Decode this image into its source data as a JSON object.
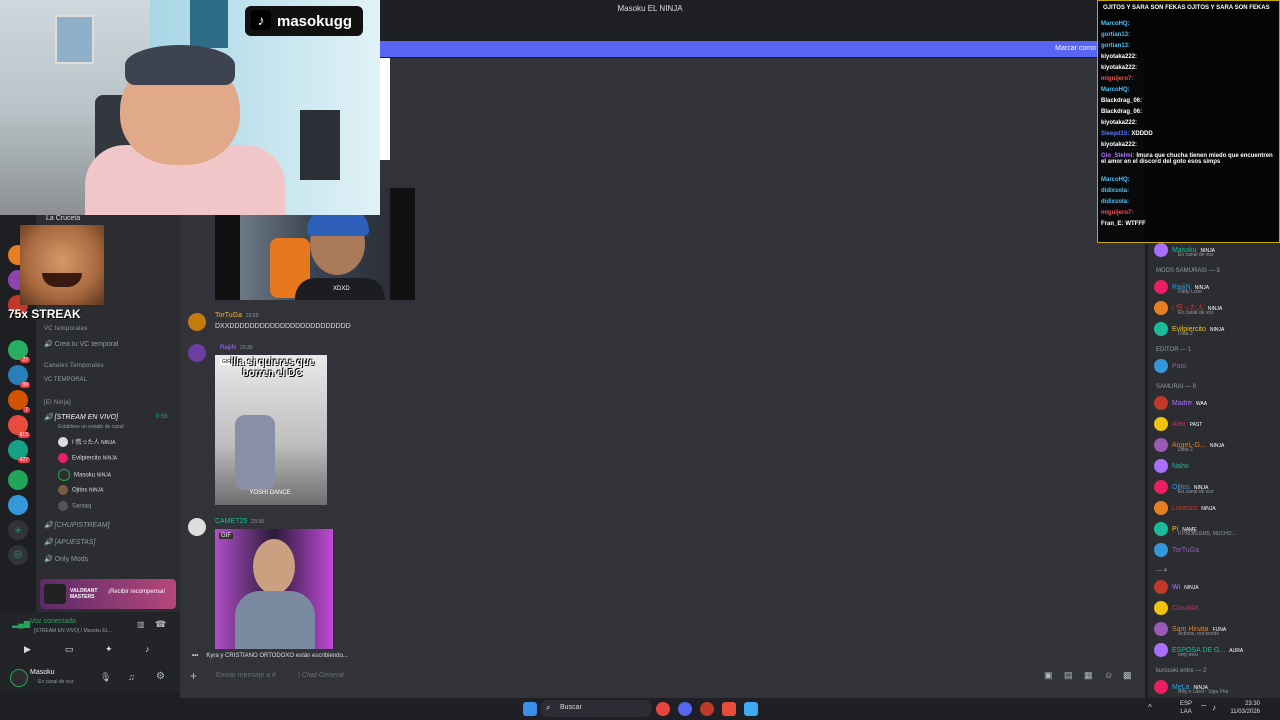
{
  "window": {
    "title": "Masoku EL NINJA"
  },
  "banner": {
    "text": "Marcar como"
  },
  "overlay": {
    "tiktok_handle": "masokugg",
    "streak": "75x STREAK",
    "cam2_label": "XDXD"
  },
  "sidebar": {
    "server_name": "La Cruceta",
    "category1": "VC temporales",
    "create_vc": "Crea tu VC temporal",
    "category2": "Canales Temporales",
    "vc_temporal": "VC TEMPORAL",
    "category3": "[El Ninja]",
    "live_channel": "[STREAM EN VIVO]",
    "live_time": "8:56",
    "live_status": "Establece un estado de canal",
    "voice_users": [
      {
        "name": "I 慌った人",
        "tag": "NINJA"
      },
      {
        "name": "Evilpiercito",
        "tag": "NINJA"
      },
      {
        "name": "Masoku",
        "tag": "NINJA"
      },
      {
        "name": "Ojitos",
        "tag": "NINJA"
      },
      {
        "name": "Saraaq",
        "tag": ""
      }
    ],
    "channels": [
      "[CHUPISTREAM]",
      "[APUESTAS]",
      "Only Mods"
    ],
    "promo_title": "VALORANT MASTERS",
    "promo_button": "¡Recibir recompensa!",
    "voice_connected": "Voz conectada",
    "voice_channel": "[STREAM EN VIVO] / Masoku EL...",
    "user_name": "Masoku",
    "user_status": "En canal de voz"
  },
  "chat": {
    "messages": [
      {
        "author": "TorTuGa",
        "time": "23:29",
        "text": "DXXDDDDDDDDDDDDDDDDDDDDDDDD",
        "color": "#c27c0e"
      },
      {
        "author": "RaijiN",
        "time": "23:30",
        "gif_caption": "illa si quieres que borren el DC",
        "gif_footer": "YOSHI DANCE",
        "color": "#a970ff"
      },
      {
        "author": "CAMET25",
        "time": "23:30",
        "gif_badge": "GIF",
        "color": "#1abc9c"
      }
    ],
    "typing": "Kyra y CRISTIANO ORTODOXO están escribiendo...",
    "composer_placeholder": "Enviar mensaje a #",
    "composer_channel": "| Chat-General"
  },
  "members": {
    "groups": [
      {
        "header": "NINJA SUPREMO — 1",
        "items": [
          {
            "name": "Masoku",
            "sub": "En canal de voz",
            "tag": "NINJA"
          }
        ]
      },
      {
        "header": "MODS SAMURAIS — 3",
        "items": [
          {
            "name": "RaijiN",
            "sub": "Dutty Love",
            "tag": "NINJA"
          },
          {
            "name": "I 慌った人",
            "sub": "En canal de voz",
            "tag": "NINJA"
          },
          {
            "name": "Evilpiercito",
            "sub": "Dota 2",
            "tag": "NINJA"
          }
        ]
      },
      {
        "header": "EDITOR — 1",
        "items": [
          {
            "name": "Pato",
            "sub": "",
            "tag": ""
          }
        ]
      },
      {
        "header": "SAMURAI — 8",
        "items": [
          {
            "name": "Madre",
            "sub": "",
            "tag": "WAA"
          },
          {
            "name": "Alex",
            "sub": "",
            "tag": "PAST"
          },
          {
            "name": "AngeL-G...",
            "sub": "Dota 2",
            "tag": "NINJA"
          },
          {
            "name": "Naho",
            "sub": "",
            "tag": ""
          },
          {
            "name": "Ojitos",
            "sub": "En canal de voz",
            "tag": "NINJA"
          },
          {
            "name": "Lorenzo",
            "sub": "",
            "tag": "NINJA"
          },
          {
            "name": "Pi",
            "sub": "0 PROBLEMS, MUCHO...",
            "tag": "NAME"
          },
          {
            "name": "TorTuGa",
            "sub": "",
            "tag": ""
          }
        ]
      },
      {
        "header": "— 4",
        "items": [
          {
            "name": "Wi",
            "sub": "",
            "tag": "NINJA"
          },
          {
            "name": "Cloud48",
            "sub": "",
            "tag": ""
          },
          {
            "name": "Sam Hinata",
            "sub": "Actions, not words",
            "tag": "FUNA"
          },
          {
            "name": "ESPOSA DE G...",
            "sub": "only uwu",
            "tag": "AURA"
          }
        ]
      },
      {
        "header": "kurosoki entre — 2",
        "items": [
          {
            "name": "MeLa",
            "sub": "Billy n Lded - Siga Fha",
            "tag": "NINJA"
          }
        ]
      }
    ]
  },
  "twitch_chat": {
    "lines": [
      {
        "user": "",
        "text": "OJITOS Y SARA SON FEKAS OJITOS Y SARA SON FEKAS",
        "color": "#ffffff"
      },
      {
        "user": "MarcoHQ:",
        "text": "",
        "color": "#4fc3f7"
      },
      {
        "user": "gortian13:",
        "text": "",
        "color": "#4fc3f7"
      },
      {
        "user": "gortian13:",
        "text": "",
        "color": "#4fc3f7"
      },
      {
        "user": "kiyotaka222:",
        "text": "",
        "color": "#ffffff"
      },
      {
        "user": "kiyotaka222:",
        "text": "",
        "color": "#ffffff"
      },
      {
        "user": "miguijero7:",
        "text": "",
        "color": "#ff4d4d"
      },
      {
        "user": "MarcoHQ:",
        "text": "",
        "color": "#4fc3f7"
      },
      {
        "user": "Blackdrag_06:",
        "text": "",
        "color": "#ffffff"
      },
      {
        "user": "Blackdrag_06:",
        "text": "",
        "color": "#ffffff"
      },
      {
        "user": "kiyotaka222:",
        "text": "",
        "color": "#ffffff"
      },
      {
        "user": "Sleepd15:",
        "text": "XDDDD",
        "color": "#4f7cff"
      },
      {
        "user": "kiyotaka222:",
        "text": "",
        "color": "#ffffff"
      },
      {
        "user": "Gio_Stelmi:",
        "text": "Imura que chucha tienen miedo que encuentren el amor en el discord del goto esos simps",
        "color": "#b57bff"
      },
      {
        "user": "MarcoHQ:",
        "text": "",
        "color": "#4fc3f7"
      },
      {
        "user": "didixsola:",
        "text": "",
        "color": "#4fc3f7"
      },
      {
        "user": "didixsola:",
        "text": "",
        "color": "#4fc3f7"
      },
      {
        "user": "miguijero7:",
        "text": "",
        "color": "#ff4d4d"
      },
      {
        "user": "Fran_E:",
        "text": "WTFFF",
        "color": "#ffffff"
      }
    ]
  },
  "taskbar": {
    "search": "Buscar",
    "lang": "ESP",
    "region": "LAA",
    "time": "23:30",
    "date": "11/03/2026"
  }
}
